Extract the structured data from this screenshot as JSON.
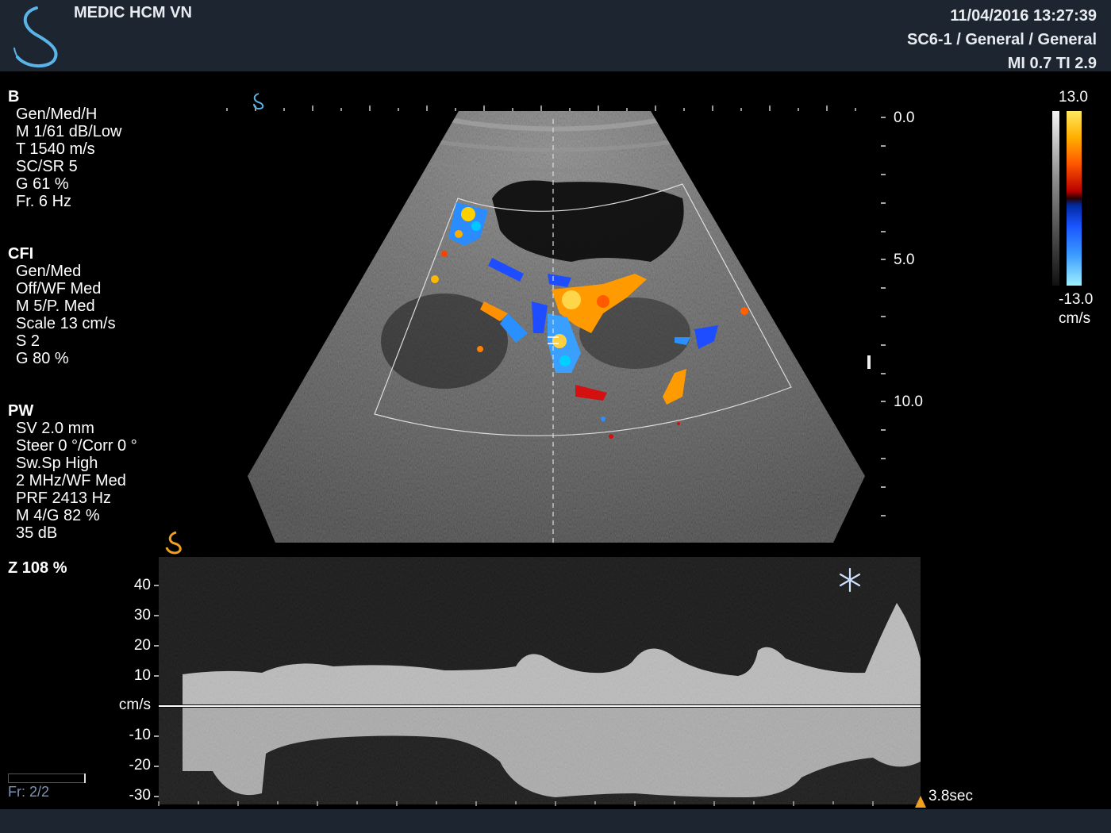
{
  "header": {
    "hospital": "MEDIC HCM VN",
    "datetime": "11/04/2016 13:27:39",
    "probe_preset": "SC6-1 / General / General",
    "mi_ti": "MI 0.7  TI 2.9"
  },
  "b_mode": {
    "title": "B",
    "lines": [
      "Gen/Med/H",
      "M 1/61 dB/Low",
      "T 1540 m/s",
      "SC/SR 5",
      "G 61 %",
      "Fr. 6 Hz"
    ]
  },
  "cfi": {
    "title": "CFI",
    "lines": [
      "Gen/Med",
      "Off/WF Med",
      "M 5/P. Med",
      "Scale 13 cm/s",
      "S 2",
      "G 80 %"
    ]
  },
  "pw": {
    "title": "PW",
    "lines": [
      "SV 2.0 mm",
      "Steer 0 °/Corr 0 °",
      "Sw.Sp High",
      "2 MHz/WF Med",
      "PRF 2413 Hz",
      "M 4/G 82 %",
      "35 dB"
    ]
  },
  "zoom": "Z  108  %",
  "frame": "Fr: 2/2",
  "depth_labels": [
    "0.0",
    "5.0",
    "10.0"
  ],
  "color_scale": {
    "max": "13.0",
    "min": "-13.0",
    "unit": "cm/s"
  },
  "spectral": {
    "velocity_labels": [
      "40",
      "30",
      "20",
      "10",
      "cm/s",
      "-10",
      "-20",
      "-30"
    ],
    "sweep_time": "3.8sec"
  },
  "icons": {
    "logo": "samsung-s-logo-icon",
    "freeze": "snowflake-icon",
    "sweep_marker": "triangle-marker-icon",
    "orientation": "orientation-marker-icon"
  },
  "colors": {
    "header_bg": "#1d2530",
    "logo_blue": "#5ab4e8",
    "doppler_marker": "#f0a020",
    "text_dim": "#7f94b4"
  }
}
